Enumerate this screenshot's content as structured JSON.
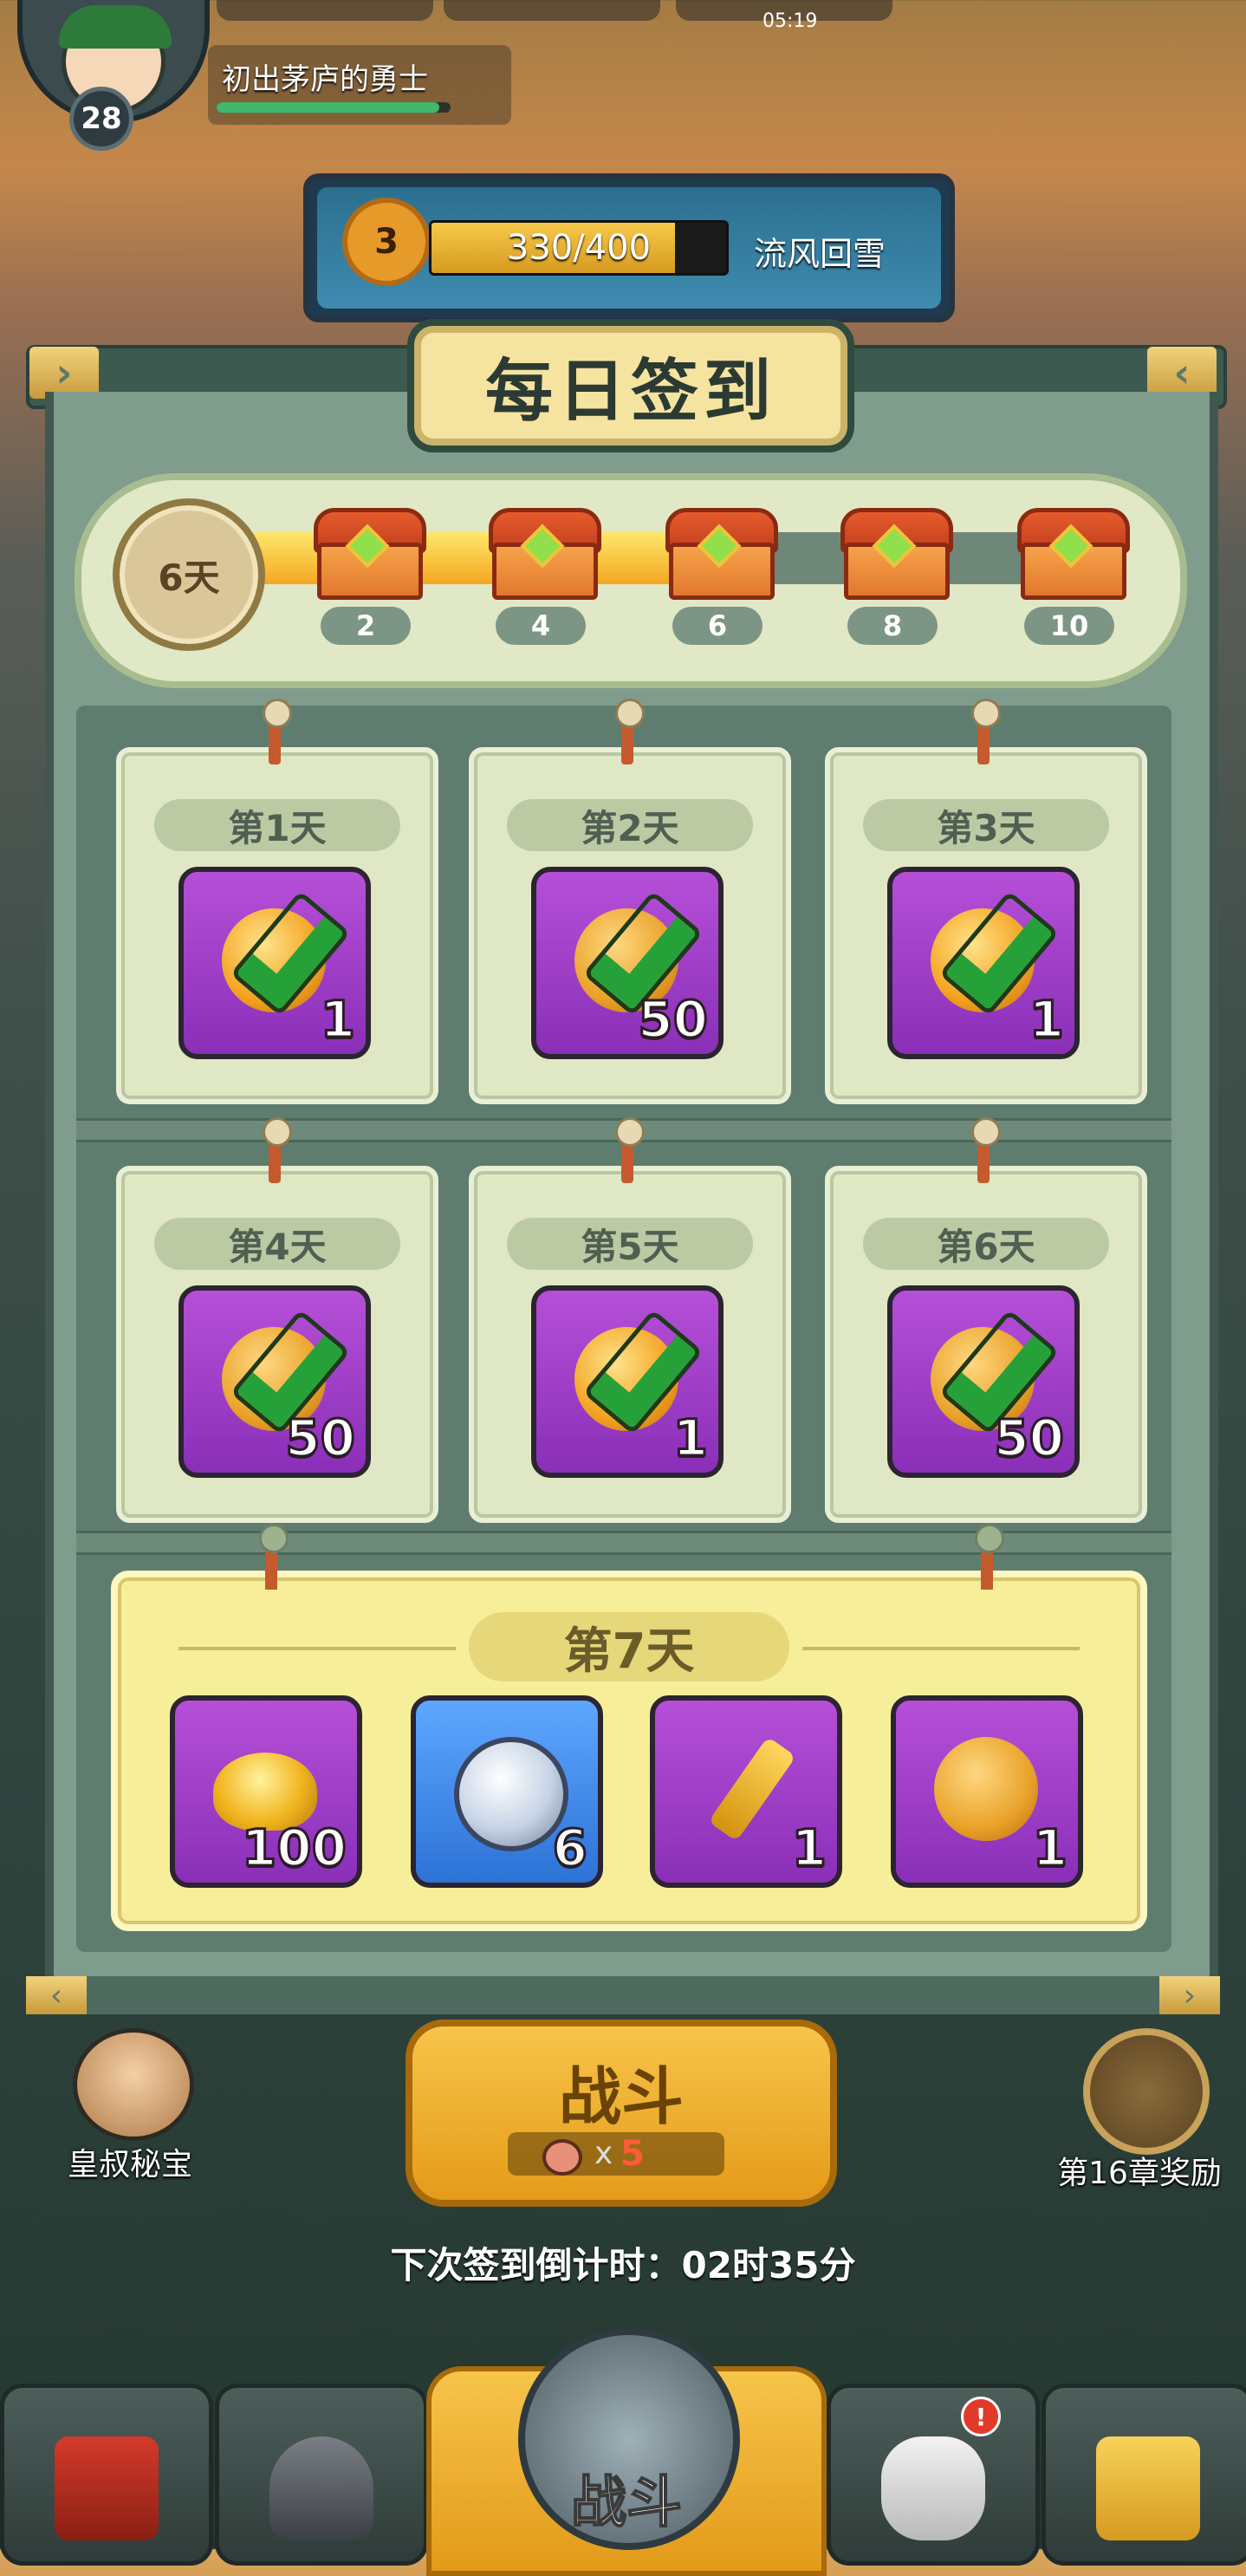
{
  "hud": {
    "level": "28",
    "title": "初出茅庐的勇士",
    "timer": "05:19"
  },
  "season": {
    "rank": "3",
    "progress_text": "330/400",
    "progress_fraction": 0.825,
    "name": "流风回雪"
  },
  "dialog": {
    "title": "每日签到",
    "signed_days_label": "6天",
    "progress_fraction": 0.55,
    "milestones": [
      {
        "count": "2",
        "opened": true
      },
      {
        "count": "4",
        "opened": true
      },
      {
        "count": "6",
        "opened": true
      },
      {
        "count": "8",
        "opened": false
      },
      {
        "count": "10",
        "opened": false
      }
    ],
    "days": [
      {
        "label": "第1天",
        "qty": "1",
        "icon": "gold-coin-icon",
        "claimed": true
      },
      {
        "label": "第2天",
        "qty": "50",
        "icon": "heart-coin-icon",
        "claimed": true
      },
      {
        "label": "第3天",
        "qty": "1",
        "icon": "gold-coin-icon",
        "claimed": true
      },
      {
        "label": "第4天",
        "qty": "50",
        "icon": "heart-coin-icon",
        "claimed": true
      },
      {
        "label": "第5天",
        "qty": "1",
        "icon": "gold-coin-icon",
        "claimed": true
      },
      {
        "label": "第6天",
        "qty": "50",
        "icon": "heart-coin-icon",
        "claimed": true
      }
    ],
    "day7": {
      "label": "第7天",
      "rewards": [
        {
          "qty": "100",
          "icon": "gold-ingot-icon",
          "color": "purple"
        },
        {
          "qty": "6",
          "icon": "silver-coin-icon",
          "color": "blue"
        },
        {
          "qty": "1",
          "icon": "golden-key-icon",
          "color": "purple"
        },
        {
          "qty": "1",
          "icon": "heart-coin-icon",
          "color": "purple"
        }
      ]
    }
  },
  "bottom": {
    "left_label": "皇叔秘宝",
    "right_label": "第16章奖励",
    "battle_label": "战斗",
    "battle_cost_x": "x",
    "battle_cost_n": "5",
    "countdown": "下次签到倒计时：02时35分",
    "nav_center_label": "战斗",
    "nav_badge": "!"
  }
}
